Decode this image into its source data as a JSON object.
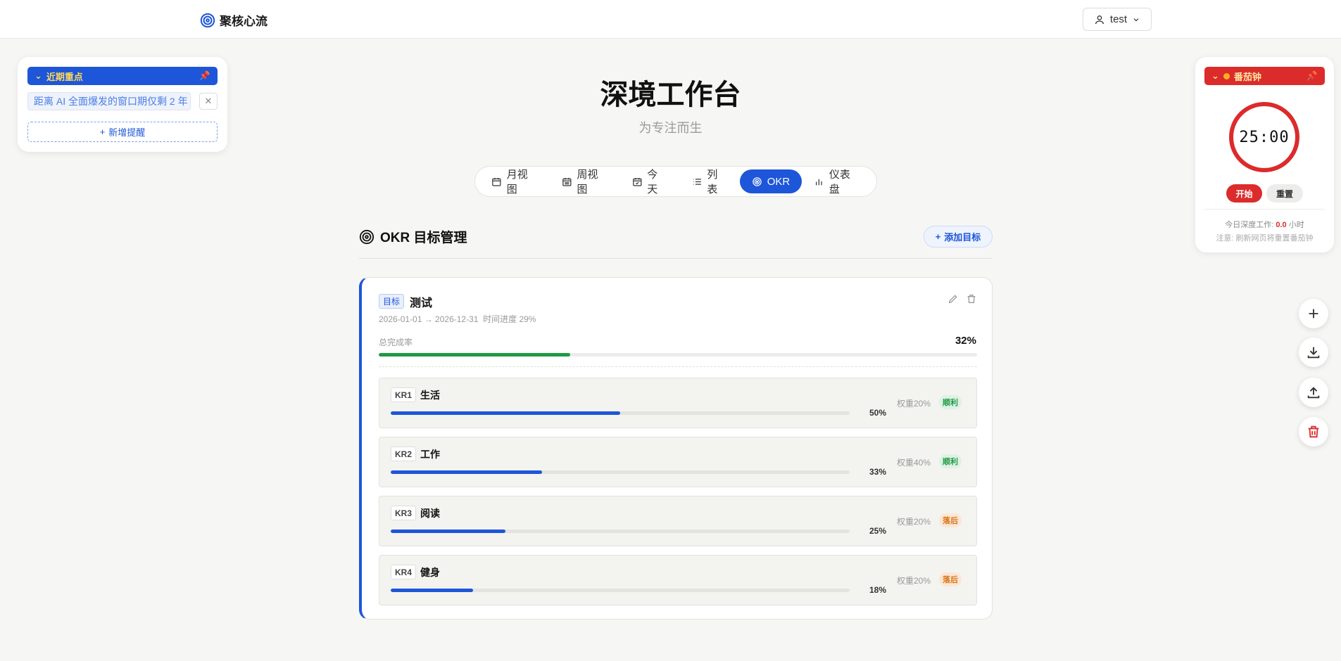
{
  "app": {
    "brand": "聚核心流",
    "user": "test"
  },
  "header": {
    "title": "深境工作台",
    "subtitle": "为专注而生"
  },
  "tabs": [
    {
      "label": "月视图",
      "icon": "calendar-icon"
    },
    {
      "label": "周视图",
      "icon": "calendar-week-icon"
    },
    {
      "label": "今天",
      "icon": "calendar-check-icon"
    },
    {
      "label": "列表",
      "icon": "list-icon"
    },
    {
      "label": "OKR",
      "icon": "target-icon",
      "active": true
    },
    {
      "label": "仪表盘",
      "icon": "bar-chart-icon"
    }
  ],
  "reminders": {
    "title": "近期重点",
    "items": [
      {
        "text": "距离 AI 全面爆发的窗口期仅剩 2 年"
      }
    ],
    "add_label": "新增提醒"
  },
  "pomodoro": {
    "title": "番茄钟",
    "time": "25:00",
    "start_label": "开始",
    "reset_label": "重置",
    "stat_prefix": "今日深度工作:",
    "stat_value": "0.0",
    "stat_unit": "小时",
    "note": "注意: 刷新网页将重置番茄钟"
  },
  "okr": {
    "section_title": "OKR 目标管理",
    "add_goal_label": "添加目标",
    "goal": {
      "badge": "目标",
      "title": "测试",
      "dates": "2026-01-01 → 2026-12-31",
      "time_progress": "时间进度 29%",
      "total_label": "总完成率",
      "total_value": "32%",
      "total_fraction": 0.32,
      "krs": [
        {
          "tag": "KR1",
          "name": "生活",
          "pct": "50%",
          "fraction": 0.5,
          "weight": "权重20%",
          "status": "顺利",
          "status_type": "good"
        },
        {
          "tag": "KR2",
          "name": "工作",
          "pct": "33%",
          "fraction": 0.33,
          "weight": "权重40%",
          "status": "顺利",
          "status_type": "good"
        },
        {
          "tag": "KR3",
          "name": "阅读",
          "pct": "25%",
          "fraction": 0.25,
          "weight": "权重20%",
          "status": "落后",
          "status_type": "behind"
        },
        {
          "tag": "KR4",
          "name": "健身",
          "pct": "18%",
          "fraction": 0.18,
          "weight": "权重20%",
          "status": "落后",
          "status_type": "behind"
        }
      ]
    }
  },
  "colors": {
    "accent": "#1d56d8",
    "danger": "#dc2b2b",
    "success": "#1e9b43",
    "warning": "#d9741a"
  }
}
